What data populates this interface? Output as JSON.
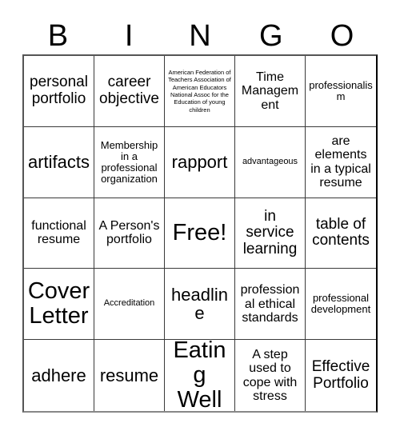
{
  "card": {
    "title": "BINGO",
    "header_letters": [
      "B",
      "I",
      "N",
      "G",
      "O"
    ],
    "free_space_label": "Free!",
    "colors": {
      "background": "#ffffff",
      "text": "#000000",
      "grid_line": "#3a3a3a",
      "outer_border": "#555555"
    },
    "grid_size": "5x5",
    "cells": [
      {
        "text": "personal portfolio",
        "size": "l",
        "free": false
      },
      {
        "text": "career objective",
        "size": "l",
        "free": false
      },
      {
        "text": "American Federation of Teachers Association of American Educators National Assoc for the Education of young children",
        "size": "xxs",
        "free": false
      },
      {
        "text": "Time Management",
        "size": "m",
        "free": false
      },
      {
        "text": "professionalism",
        "size": "s",
        "free": false
      },
      {
        "text": "artifacts",
        "size": "xl",
        "free": false
      },
      {
        "text": "Membership in a professional organization",
        "size": "s",
        "free": false
      },
      {
        "text": "rapport",
        "size": "xl",
        "free": false
      },
      {
        "text": "advantageous",
        "size": "xs",
        "free": false
      },
      {
        "text": "are elements in a typical resume",
        "size": "m",
        "free": false
      },
      {
        "text": "functional resume",
        "size": "m",
        "free": false
      },
      {
        "text": "A Person's portfolio",
        "size": "m",
        "free": false
      },
      {
        "text": "Free!",
        "size": "xxl",
        "free": true
      },
      {
        "text": "in service learning",
        "size": "l",
        "free": false
      },
      {
        "text": "table of contents",
        "size": "l",
        "free": false
      },
      {
        "text": "Cover Letter",
        "size": "xxl",
        "free": false
      },
      {
        "text": "Accreditation",
        "size": "xs",
        "free": false
      },
      {
        "text": "headline",
        "size": "xl",
        "free": false
      },
      {
        "text": "professional ethical standards",
        "size": "m",
        "free": false
      },
      {
        "text": "professional development",
        "size": "s",
        "free": false
      },
      {
        "text": "adhere",
        "size": "xl",
        "free": false
      },
      {
        "text": "resume",
        "size": "xl",
        "free": false
      },
      {
        "text": "Eating Well",
        "size": "xxl",
        "free": false
      },
      {
        "text": "A step used to cope with stress",
        "size": "m",
        "free": false
      },
      {
        "text": "Effective Portfolio",
        "size": "l",
        "free": false
      }
    ]
  }
}
